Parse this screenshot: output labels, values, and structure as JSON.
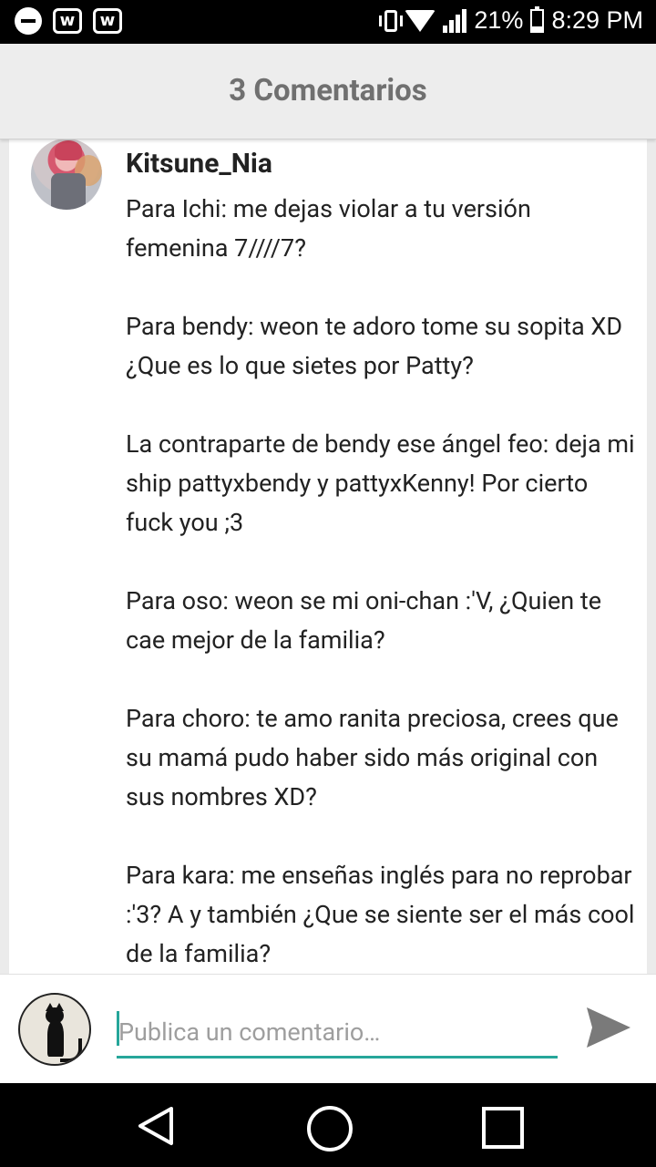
{
  "status_bar": {
    "battery": "21%",
    "time": "8:29 PM",
    "left_icons": [
      "minus-circle-icon",
      "wattpad-icon",
      "wattpad-icon"
    ],
    "right_icons": [
      "vibrate-icon",
      "wifi-icon",
      "signal-icon",
      "battery-icon"
    ]
  },
  "header": {
    "title": "3 Comentarios"
  },
  "comment": {
    "username": "Kitsune_Nia",
    "paragraphs": [
      "Para Ichi: me dejas violar a tu versión femenina 7////7?",
      "Para bendy: weon te adoro tome su sopita XD ¿Que es lo que sietes por Patty?",
      "La contraparte de bendy ese ángel feo: deja mi ship pattyxbendy y pattyxKenny! Por cierto fuck you ;3",
      "Para oso: weon se mi oni-chan :'V,  ¿Quien te cae mejor de la familia?",
      "Para choro: te amo ranita preciosa, crees que su mamá pudo haber sido más original con sus nombres XD?",
      "Para kara: me enseñas inglés para no reprobar :'3? A y también ¿Que se siente ser el más cool de la familia?"
    ]
  },
  "composer": {
    "placeholder": "Publica un comentario…",
    "value": "",
    "accent_color": "#26a69a"
  },
  "navbar": {
    "icons": [
      "back-icon",
      "home-icon",
      "recent-apps-icon"
    ]
  }
}
